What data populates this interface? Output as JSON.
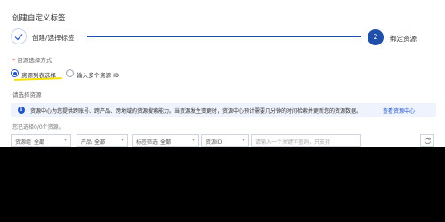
{
  "dialog": {
    "title": "创建自定义标签"
  },
  "steps": [
    {
      "number": "",
      "label": "创建/选择标签",
      "state": "done"
    },
    {
      "number": "2",
      "label": "绑定资源",
      "state": "active"
    }
  ],
  "method": {
    "label": "资源选择方式",
    "options": [
      {
        "label": "资源列表选择",
        "checked": true
      },
      {
        "label": "输入多个资源 ID",
        "checked": false
      }
    ]
  },
  "select_section": {
    "label": "请选择资源"
  },
  "info": {
    "text": "资源中心为您提供跨账号、跨产品、跨地域的资源搜索能力。当资源发生变更时，资源中心预计需要几分钟的时间检索并更新您的资源数据。",
    "link": "查看资源中心"
  },
  "count_text": "您已选择0/0个资源。",
  "filters": [
    {
      "label": "资源组",
      "value": "全部"
    },
    {
      "label": "产品",
      "value": "全部"
    },
    {
      "label": "标签筛选",
      "value": "全部"
    },
    {
      "label": "资源ID",
      "value": ""
    },
    {
      "placeholder": "请输入一个关键字查询，只支持"
    }
  ],
  "colors": {
    "primary": "#1f4fa8",
    "info_bg": "#eef3fd",
    "highlight": "#f5e000"
  }
}
